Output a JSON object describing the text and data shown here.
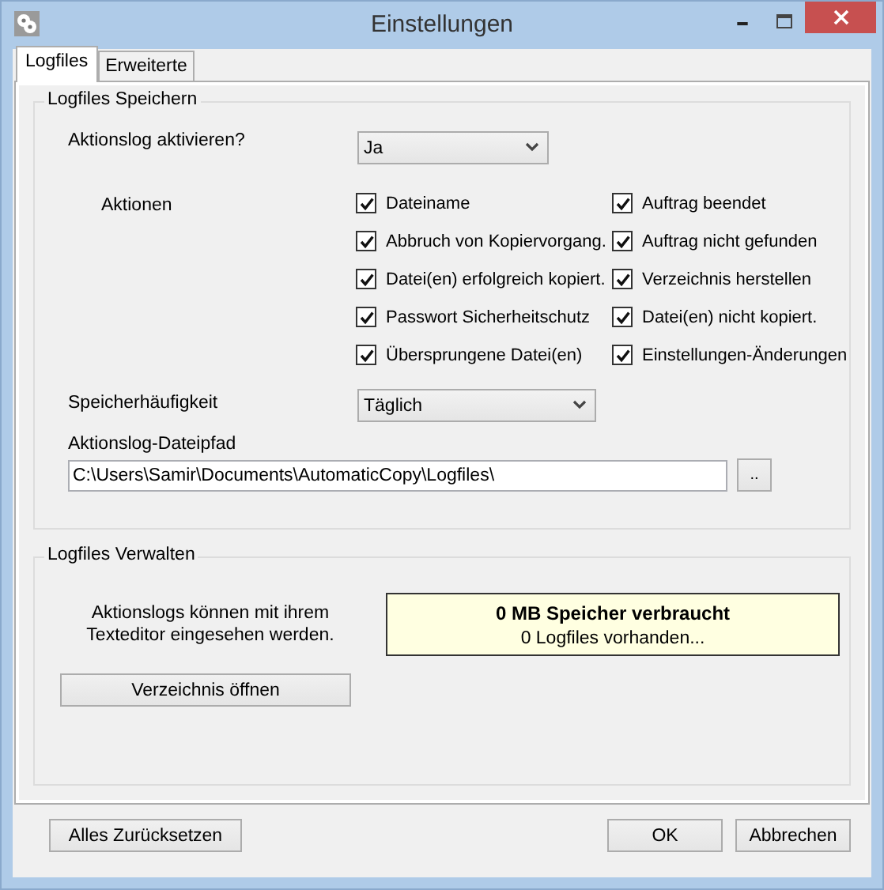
{
  "window": {
    "title": "Einstellungen"
  },
  "tabs": [
    {
      "label": "Logfiles",
      "selected": true
    },
    {
      "label": "Erweiterte",
      "selected": false
    }
  ],
  "save_group": {
    "title": "Logfiles Speichern",
    "activate": {
      "label": "Aktionslog aktivieren?",
      "value": "Ja"
    },
    "actions_label": "Aktionen",
    "actions": [
      {
        "label": "Dateiname",
        "checked": true
      },
      {
        "label": "Auftrag beendet",
        "checked": true
      },
      {
        "label": "Abbruch von Kopiervorgang.",
        "checked": true
      },
      {
        "label": "Auftrag nicht gefunden",
        "checked": true
      },
      {
        "label": "Datei(en) erfolgreich kopiert.",
        "checked": true
      },
      {
        "label": "Verzeichnis herstellen",
        "checked": true
      },
      {
        "label": "Passwort Sicherheitschutz",
        "checked": true
      },
      {
        "label": "Datei(en) nicht kopiert.",
        "checked": true
      },
      {
        "label": "Übersprungene Datei(en)",
        "checked": true
      },
      {
        "label": "Einstellungen-Änderungen",
        "checked": true
      }
    ],
    "frequency": {
      "label": "Speicherhäufigkeit",
      "value": "Täglich"
    },
    "path": {
      "label": "Aktionslog-Dateipfad",
      "value": "C:\\Users\\Samir\\Documents\\AutomaticCopy\\Logfiles\\",
      "browse": ".."
    }
  },
  "manage_group": {
    "title": "Logfiles Verwalten",
    "hint": "Aktionslogs können mit ihrem Texteditor eingesehen werden.",
    "usage": "0 MB Speicher verbraucht",
    "count": "0 Logfiles vorhanden...",
    "open_button": "Verzeichnis öffnen"
  },
  "buttons": {
    "reset": "Alles Zurücksetzen",
    "ok": "OK",
    "cancel": "Abbrechen"
  }
}
